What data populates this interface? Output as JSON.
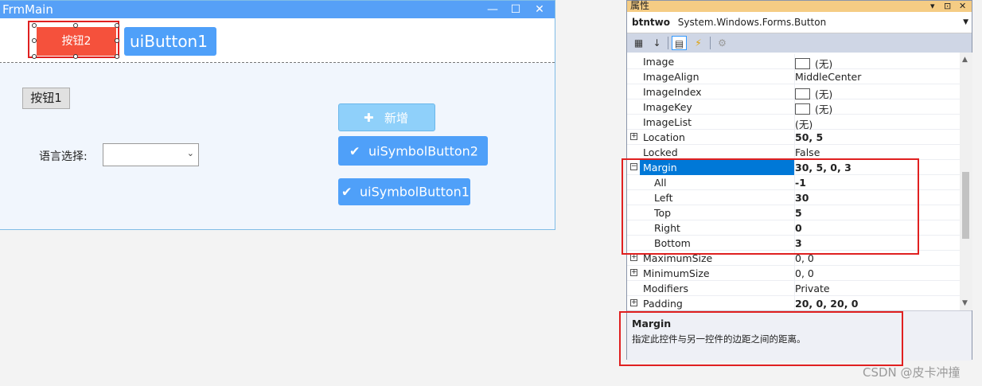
{
  "form": {
    "title": "FrmMain",
    "minimize_glyph": "—",
    "maximize_glyph": "☐",
    "close_glyph": "✕",
    "button2_label": "按钮2",
    "uibutton1_label": "uiButton1",
    "button1_label": "按钮1",
    "language_label": "语言选择:",
    "combo_arrow": "⌄",
    "add_label": "新增",
    "add_icon": "plus-icon",
    "sym2_label": "uiSymbolButton2",
    "sym1_label": "uiSymbolButton1",
    "check_glyph": "✔",
    "plus_glyph": "✚"
  },
  "props": {
    "panel_title": "属性",
    "object_name": "btntwo",
    "object_type": "System.Windows.Forms.Button",
    "rows": [
      {
        "name": "Image",
        "value": "(无)",
        "swatch": true
      },
      {
        "name": "ImageAlign",
        "value": "MiddleCenter"
      },
      {
        "name": "ImageIndex",
        "value": "(无)",
        "swatch": true
      },
      {
        "name": "ImageKey",
        "value": "(无)",
        "swatch": true
      },
      {
        "name": "ImageList",
        "value": "(无)"
      },
      {
        "name": "Location",
        "value": "50, 5",
        "bold": true,
        "expander": "+"
      },
      {
        "name": "Locked",
        "value": "False"
      },
      {
        "name": "Margin",
        "value": "30, 5, 0, 3",
        "bold": true,
        "expander": "−",
        "selected": true
      },
      {
        "name": "All",
        "value": "-1",
        "bold": true,
        "sub": true
      },
      {
        "name": "Left",
        "value": "30",
        "bold": true,
        "sub": true
      },
      {
        "name": "Top",
        "value": "5",
        "bold": true,
        "sub": true
      },
      {
        "name": "Right",
        "value": "0",
        "bold": true,
        "sub": true
      },
      {
        "name": "Bottom",
        "value": "3",
        "bold": true,
        "sub": true
      },
      {
        "name": "MaximumSize",
        "value": "0, 0",
        "expander": "+"
      },
      {
        "name": "MinimumSize",
        "value": "0, 0",
        "expander": "+"
      },
      {
        "name": "Modifiers",
        "value": "Private"
      },
      {
        "name": "Padding",
        "value": "20, 0, 20, 0",
        "bold": true,
        "expander": "+"
      }
    ],
    "desc_title": "Margin",
    "desc_text": "指定此控件与另一控件的边距之间的距离。"
  },
  "watermark": "CSDN @皮卡冲撞"
}
